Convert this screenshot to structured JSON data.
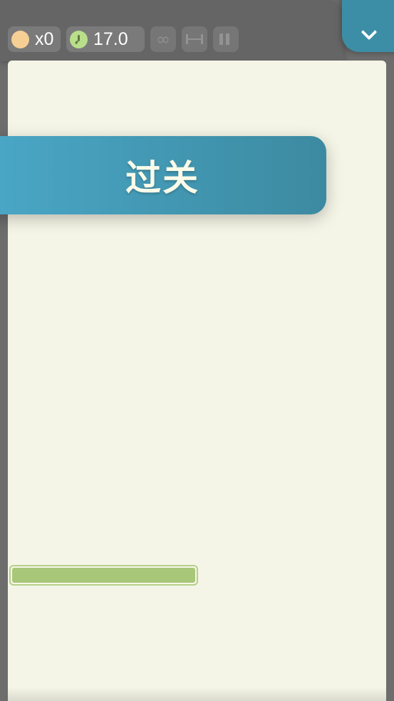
{
  "hud": {
    "coins": {
      "icon": "coin-icon",
      "label": "x0",
      "color": "#f6cf95"
    },
    "timer": {
      "icon": "clock-icon",
      "label": "17.0",
      "color": "#b9df8b"
    },
    "tools": [
      {
        "name": "infinity-button",
        "icon": "infinity-icon",
        "glyph": "∞",
        "enabled": false
      },
      {
        "name": "fit-width-button",
        "icon": "fit-width-icon",
        "enabled": false
      },
      {
        "name": "pause-button",
        "icon": "pause-icon",
        "enabled": false
      }
    ],
    "collapse_button": {
      "icon": "chevron-down-icon"
    }
  },
  "banner": {
    "text": "过关",
    "color": "#4aa7c6"
  },
  "progress": {
    "fraction": 1.0,
    "fill_color": "#a9c778"
  }
}
